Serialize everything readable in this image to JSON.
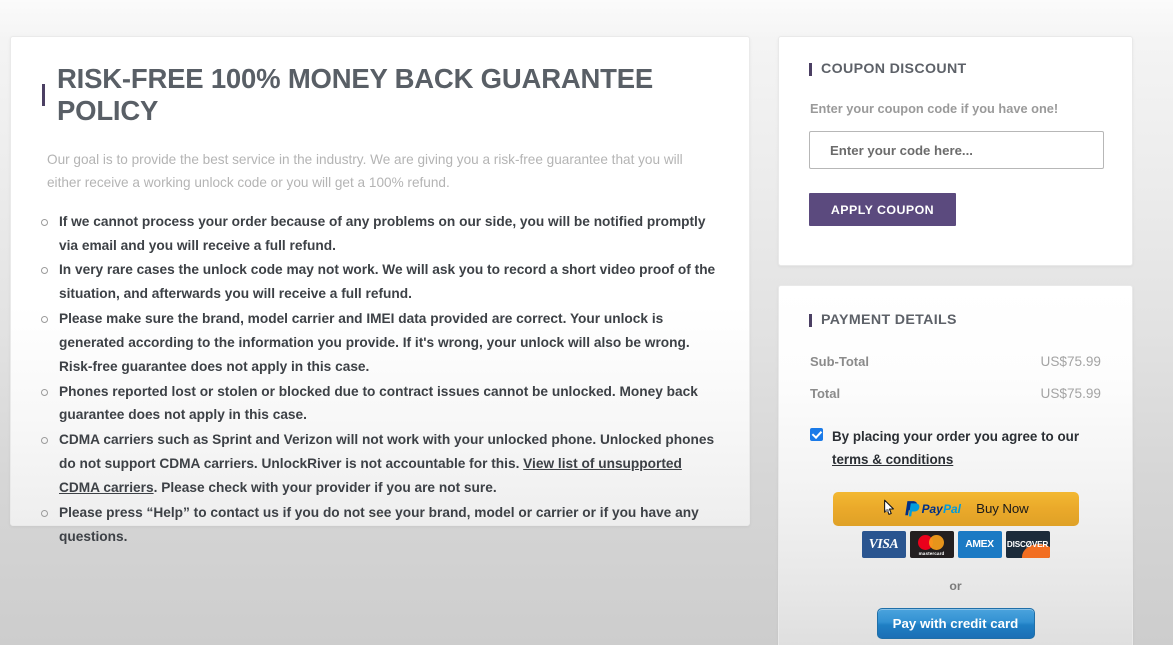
{
  "policy": {
    "title": "RISK-FREE 100% MONEY BACK GUARANTEE POLICY",
    "intro": "Our goal is to provide the best service in the industry. We are giving you a risk-free guarantee that you will either receive a working unlock code or you will get a 100% refund.",
    "items": [
      {
        "text": "If we cannot process your order because of any problems on our side, you will be notified promptly via email and you will receive a full refund."
      },
      {
        "text": "In very rare cases the unlock code may not work. We will ask you to record a short video proof of the situation, and afterwards you will receive a full refund."
      },
      {
        "text": "Please make sure the brand, model carrier and IMEI data provided are correct. Your unlock is generated according to the information you provide. If it's wrong, your unlock will also be wrong. Risk-free guarantee does not apply in this case."
      },
      {
        "text": "Phones reported lost or stolen or blocked due to contract issues cannot be unlocked. Money back guarantee does not apply in this case."
      },
      {
        "text_before": "CDMA carriers such as Sprint and Verizon will not work with your unlocked phone. Unlocked phones do not support CDMA carriers. UnlockRiver is not accountable for this. ",
        "link": "View list of unsupported CDMA carriers",
        "text_after": ". Please check with your provider if you are not sure."
      },
      {
        "text": "Please press “Help” to contact us if you do not see your brand, model or carrier or if you have any questions."
      }
    ]
  },
  "coupon": {
    "title": "COUPON DISCOUNT",
    "hint": "Enter your coupon code if you have one!",
    "input_value": "",
    "input_placeholder": "Enter your code here...",
    "apply_label": "APPLY COUPON"
  },
  "payment": {
    "title": "PAYMENT DETAILS",
    "rows": [
      {
        "label": "Sub-Total",
        "value": "US$75.99"
      },
      {
        "label": "Total",
        "value": "US$75.99"
      }
    ],
    "agree_checked": true,
    "agree_text": "By placing your order you agree to our ",
    "agree_link": "terms & conditions",
    "paypal_brand_pay": "Pay",
    "paypal_brand_pal": "Pal",
    "paypal_buy_now": "Buy Now",
    "card_logos": [
      {
        "name": "visa",
        "label": "VISA"
      },
      {
        "name": "mastercard",
        "label": "mastercard"
      },
      {
        "name": "amex",
        "label": "AMEX"
      },
      {
        "name": "discover",
        "label": "DISCØVER"
      }
    ],
    "or_label": "or",
    "credit_card_label": "Pay with credit card"
  },
  "colors": {
    "accent_purple": "#4b3f63",
    "apply_button": "#5b4a7e",
    "paypal_gold": "#eaa92a",
    "checkbox_blue": "#1a7ae8",
    "cc_button_blue": "#3291d2"
  }
}
